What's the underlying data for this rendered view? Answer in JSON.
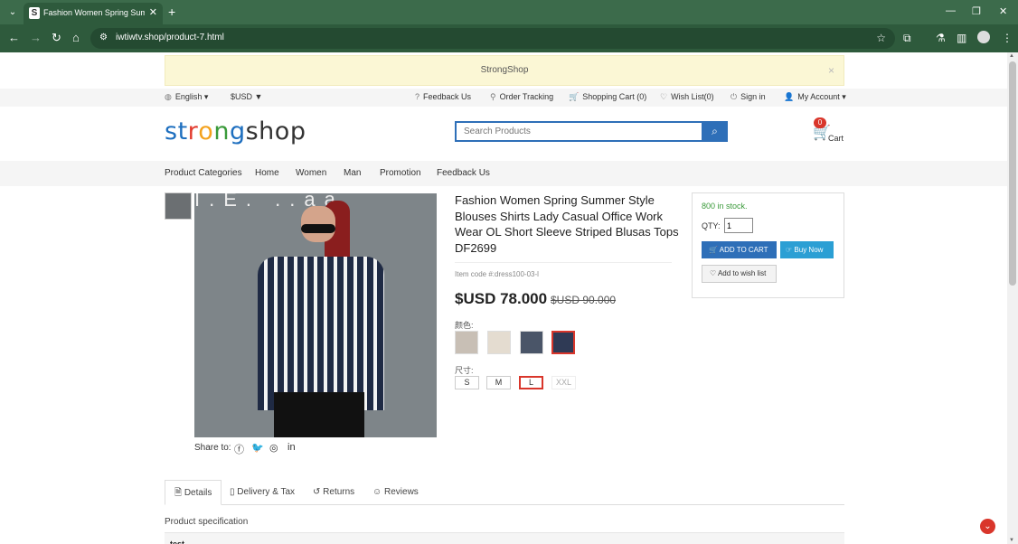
{
  "browser": {
    "tab_title": "Fashion Women Spring Summe",
    "tab_favicon": "S",
    "url": "iwtiwtv.shop/product-7.html",
    "new_tab": "+",
    "close_tab": "✕",
    "minimize": "—",
    "restore": "❐",
    "close_window": "✕",
    "back": "←",
    "forward": "→",
    "reload": "↻",
    "home": "⌂",
    "star": "☆"
  },
  "notice": {
    "text": "StrongShop",
    "close": "×"
  },
  "topbar": {
    "language": "English",
    "currency": "$USD",
    "feedback": "Feedback Us",
    "order_tracking": "Order Tracking",
    "shopping_cart": "Shopping Cart (0)",
    "wish_list": "Wish List(0)",
    "sign_in": "Sign in",
    "my_account": "My Account"
  },
  "header": {
    "logo_letters": [
      "s",
      "t",
      "r",
      "o",
      "n",
      "g",
      "s",
      "h",
      "o",
      "p"
    ],
    "logo_colors": [
      "#1e6fbf",
      "#1e6fbf",
      "#e23b2e",
      "#f4a21d",
      "#3a9a3a",
      "#1e6fbf",
      "#333333",
      "#333333",
      "#333333",
      "#333333"
    ],
    "search_placeholder": "Search Products",
    "cart_count": "0",
    "cart_label": "Cart"
  },
  "menu": {
    "items": [
      "Product Categories",
      "Home",
      "Women",
      "Man",
      "Promotion",
      "Feedback Us"
    ]
  },
  "product": {
    "title": "Fashion Women Spring Summer Style Blouses Shirts Lady Casual Office Work Wear OL Short Sleeve Striped Blusas Tops DF2699",
    "item_code": "Item code #:dress100-03-l",
    "price": "$USD 78.000",
    "old_price": "$USD 90.000",
    "color_label": "颜色:",
    "size_label": "尺寸:",
    "sizes": [
      "S",
      "M",
      "L",
      "XXL"
    ],
    "selected_size": "L",
    "share_label": "Share to:",
    "image_banner_text": "I.E. ..aa"
  },
  "buybox": {
    "stock": "800 in stock.",
    "qty_label": "QTY:",
    "qty_value": "1",
    "add_to_cart": "ADD TO CART",
    "buy_now": "Buy Now",
    "add_to_wish": "Add to wish list"
  },
  "tabs": {
    "details": "Details",
    "delivery": "Delivery & Tax",
    "returns": "Returns",
    "reviews": "Reviews"
  },
  "spec": {
    "heading": "Product specification",
    "first_row": "test"
  },
  "colors": {
    "brand_blue": "#2e6fb8",
    "accent_red": "#d9362b",
    "stock_green": "#3a9a3a"
  }
}
